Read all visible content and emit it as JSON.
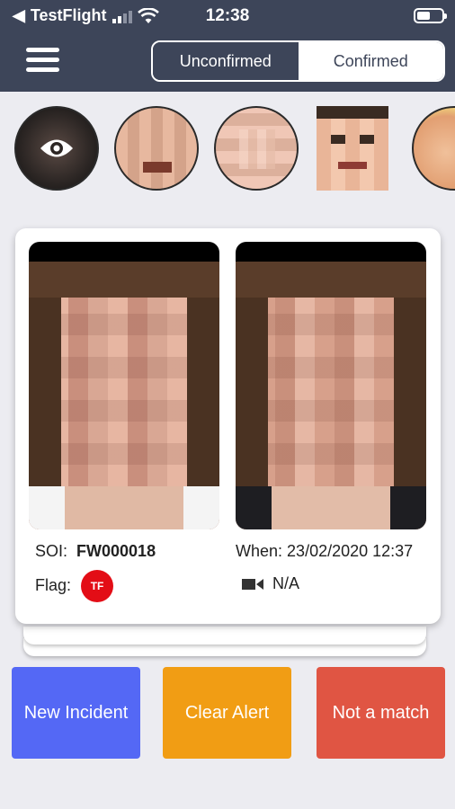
{
  "status": {
    "carrier": "TestFlight",
    "time": "12:38"
  },
  "segmented": {
    "unconfirmed": "Unconfirmed",
    "confirmed": "Confirmed"
  },
  "alert": {
    "soi_label": "SOI:",
    "soi_value": "FW000018",
    "when_label": "When:",
    "when_value": "23/02/2020 12:37",
    "flag_label": "Flag:",
    "flag_badge": "TF",
    "camera_value": "N/A"
  },
  "actions": {
    "new_incident": "New Incident",
    "clear_alert": "Clear Alert",
    "not_match": "Not a match"
  },
  "colors": {
    "header": "#3d4559",
    "new_incident": "#5468f5",
    "clear_alert": "#f19d14",
    "not_match": "#e05543",
    "flag": "#e30d16"
  }
}
